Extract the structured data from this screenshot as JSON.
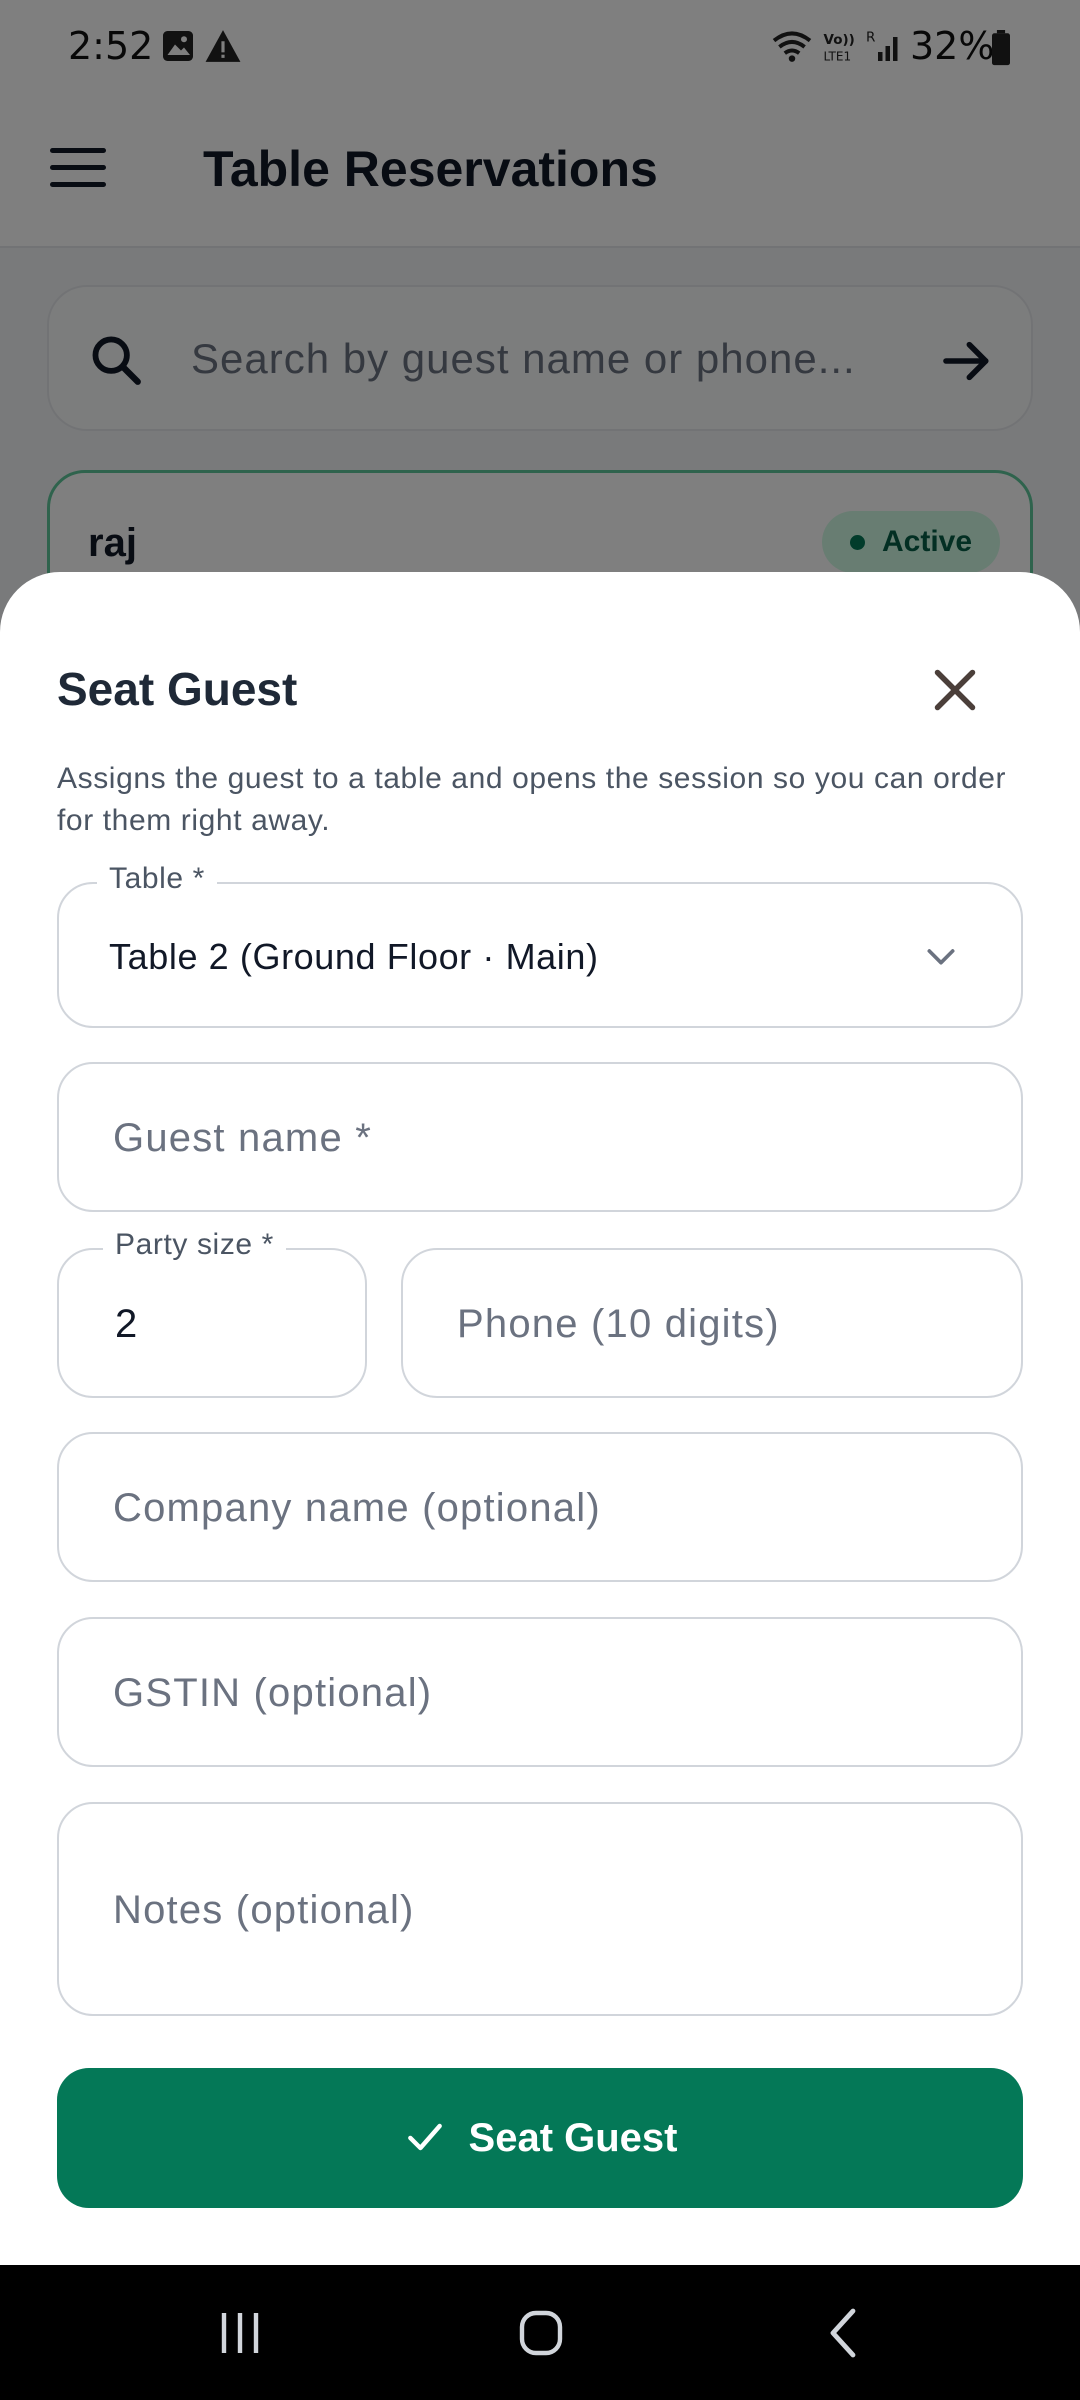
{
  "status_bar": {
    "time": "2:52",
    "battery": "32%",
    "icons": [
      "image-icon",
      "warning-icon",
      "wifi-icon",
      "volte-icon",
      "signal-icon",
      "battery-icon"
    ]
  },
  "app_bar": {
    "title": "Table Reservations",
    "menu_icon": "menu-icon"
  },
  "search": {
    "placeholder": "Search by guest name or phone...",
    "icon": "search-icon",
    "submit_icon": "arrow-right-icon"
  },
  "reservation_card": {
    "name": "raj",
    "status": "Active",
    "status_color": "#047857"
  },
  "dialog": {
    "title": "Seat Guest",
    "close_icon": "close-icon",
    "description": "Assigns the guest to a table and opens the session so you can order for them right away.",
    "table_field": {
      "label": "Table *",
      "value": "Table 2  (Ground Floor · Main)",
      "icon": "chevron-down-icon"
    },
    "guest_name": {
      "placeholder": "Guest name *",
      "value": ""
    },
    "party_size": {
      "label": "Party size *",
      "value": "2"
    },
    "phone": {
      "placeholder": "Phone (10 digits)",
      "value": ""
    },
    "company": {
      "placeholder": "Company name (optional)",
      "value": ""
    },
    "gstin": {
      "placeholder": "GSTIN (optional)",
      "value": ""
    },
    "notes": {
      "placeholder": "Notes (optional)",
      "value": ""
    },
    "submit": {
      "label": "Seat Guest",
      "icon": "check-icon",
      "color": "#047857"
    }
  },
  "nav_bar": {
    "icons": [
      "recents-icon",
      "home-icon",
      "back-icon"
    ]
  }
}
